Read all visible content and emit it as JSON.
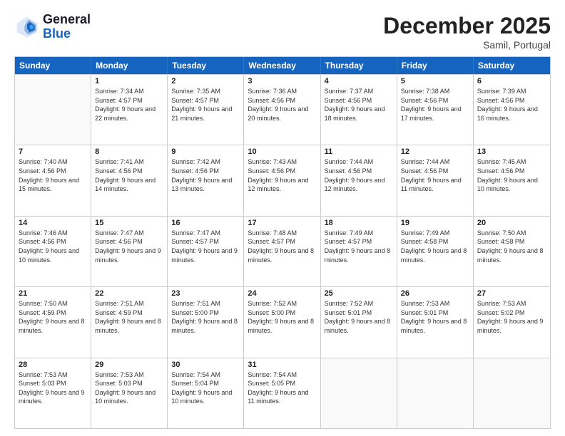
{
  "header": {
    "logo_line1": "General",
    "logo_line2": "Blue",
    "title": "December 2025",
    "subtitle": "Samil, Portugal"
  },
  "days_of_week": [
    "Sunday",
    "Monday",
    "Tuesday",
    "Wednesday",
    "Thursday",
    "Friday",
    "Saturday"
  ],
  "weeks": [
    [
      {
        "day": "",
        "sunrise": "",
        "sunset": "",
        "daylight": ""
      },
      {
        "day": "1",
        "sunrise": "Sunrise: 7:34 AM",
        "sunset": "Sunset: 4:57 PM",
        "daylight": "Daylight: 9 hours and 22 minutes."
      },
      {
        "day": "2",
        "sunrise": "Sunrise: 7:35 AM",
        "sunset": "Sunset: 4:57 PM",
        "daylight": "Daylight: 9 hours and 21 minutes."
      },
      {
        "day": "3",
        "sunrise": "Sunrise: 7:36 AM",
        "sunset": "Sunset: 4:56 PM",
        "daylight": "Daylight: 9 hours and 20 minutes."
      },
      {
        "day": "4",
        "sunrise": "Sunrise: 7:37 AM",
        "sunset": "Sunset: 4:56 PM",
        "daylight": "Daylight: 9 hours and 18 minutes."
      },
      {
        "day": "5",
        "sunrise": "Sunrise: 7:38 AM",
        "sunset": "Sunset: 4:56 PM",
        "daylight": "Daylight: 9 hours and 17 minutes."
      },
      {
        "day": "6",
        "sunrise": "Sunrise: 7:39 AM",
        "sunset": "Sunset: 4:56 PM",
        "daylight": "Daylight: 9 hours and 16 minutes."
      }
    ],
    [
      {
        "day": "7",
        "sunrise": "Sunrise: 7:40 AM",
        "sunset": "Sunset: 4:56 PM",
        "daylight": "Daylight: 9 hours and 15 minutes."
      },
      {
        "day": "8",
        "sunrise": "Sunrise: 7:41 AM",
        "sunset": "Sunset: 4:56 PM",
        "daylight": "Daylight: 9 hours and 14 minutes."
      },
      {
        "day": "9",
        "sunrise": "Sunrise: 7:42 AM",
        "sunset": "Sunset: 4:56 PM",
        "daylight": "Daylight: 9 hours and 13 minutes."
      },
      {
        "day": "10",
        "sunrise": "Sunrise: 7:43 AM",
        "sunset": "Sunset: 4:56 PM",
        "daylight": "Daylight: 9 hours and 12 minutes."
      },
      {
        "day": "11",
        "sunrise": "Sunrise: 7:44 AM",
        "sunset": "Sunset: 4:56 PM",
        "daylight": "Daylight: 9 hours and 12 minutes."
      },
      {
        "day": "12",
        "sunrise": "Sunrise: 7:44 AM",
        "sunset": "Sunset: 4:56 PM",
        "daylight": "Daylight: 9 hours and 11 minutes."
      },
      {
        "day": "13",
        "sunrise": "Sunrise: 7:45 AM",
        "sunset": "Sunset: 4:56 PM",
        "daylight": "Daylight: 9 hours and 10 minutes."
      }
    ],
    [
      {
        "day": "14",
        "sunrise": "Sunrise: 7:46 AM",
        "sunset": "Sunset: 4:56 PM",
        "daylight": "Daylight: 9 hours and 10 minutes."
      },
      {
        "day": "15",
        "sunrise": "Sunrise: 7:47 AM",
        "sunset": "Sunset: 4:56 PM",
        "daylight": "Daylight: 9 hours and 9 minutes."
      },
      {
        "day": "16",
        "sunrise": "Sunrise: 7:47 AM",
        "sunset": "Sunset: 4:57 PM",
        "daylight": "Daylight: 9 hours and 9 minutes."
      },
      {
        "day": "17",
        "sunrise": "Sunrise: 7:48 AM",
        "sunset": "Sunset: 4:57 PM",
        "daylight": "Daylight: 9 hours and 8 minutes."
      },
      {
        "day": "18",
        "sunrise": "Sunrise: 7:49 AM",
        "sunset": "Sunset: 4:57 PM",
        "daylight": "Daylight: 9 hours and 8 minutes."
      },
      {
        "day": "19",
        "sunrise": "Sunrise: 7:49 AM",
        "sunset": "Sunset: 4:58 PM",
        "daylight": "Daylight: 9 hours and 8 minutes."
      },
      {
        "day": "20",
        "sunrise": "Sunrise: 7:50 AM",
        "sunset": "Sunset: 4:58 PM",
        "daylight": "Daylight: 9 hours and 8 minutes."
      }
    ],
    [
      {
        "day": "21",
        "sunrise": "Sunrise: 7:50 AM",
        "sunset": "Sunset: 4:59 PM",
        "daylight": "Daylight: 9 hours and 8 minutes."
      },
      {
        "day": "22",
        "sunrise": "Sunrise: 7:51 AM",
        "sunset": "Sunset: 4:59 PM",
        "daylight": "Daylight: 9 hours and 8 minutes."
      },
      {
        "day": "23",
        "sunrise": "Sunrise: 7:51 AM",
        "sunset": "Sunset: 5:00 PM",
        "daylight": "Daylight: 9 hours and 8 minutes."
      },
      {
        "day": "24",
        "sunrise": "Sunrise: 7:52 AM",
        "sunset": "Sunset: 5:00 PM",
        "daylight": "Daylight: 9 hours and 8 minutes."
      },
      {
        "day": "25",
        "sunrise": "Sunrise: 7:52 AM",
        "sunset": "Sunset: 5:01 PM",
        "daylight": "Daylight: 9 hours and 8 minutes."
      },
      {
        "day": "26",
        "sunrise": "Sunrise: 7:53 AM",
        "sunset": "Sunset: 5:01 PM",
        "daylight": "Daylight: 9 hours and 8 minutes."
      },
      {
        "day": "27",
        "sunrise": "Sunrise: 7:53 AM",
        "sunset": "Sunset: 5:02 PM",
        "daylight": "Daylight: 9 hours and 9 minutes."
      }
    ],
    [
      {
        "day": "28",
        "sunrise": "Sunrise: 7:53 AM",
        "sunset": "Sunset: 5:03 PM",
        "daylight": "Daylight: 9 hours and 9 minutes."
      },
      {
        "day": "29",
        "sunrise": "Sunrise: 7:53 AM",
        "sunset": "Sunset: 5:03 PM",
        "daylight": "Daylight: 9 hours and 10 minutes."
      },
      {
        "day": "30",
        "sunrise": "Sunrise: 7:54 AM",
        "sunset": "Sunset: 5:04 PM",
        "daylight": "Daylight: 9 hours and 10 minutes."
      },
      {
        "day": "31",
        "sunrise": "Sunrise: 7:54 AM",
        "sunset": "Sunset: 5:05 PM",
        "daylight": "Daylight: 9 hours and 11 minutes."
      },
      {
        "day": "",
        "sunrise": "",
        "sunset": "",
        "daylight": ""
      },
      {
        "day": "",
        "sunrise": "",
        "sunset": "",
        "daylight": ""
      },
      {
        "day": "",
        "sunrise": "",
        "sunset": "",
        "daylight": ""
      }
    ]
  ]
}
